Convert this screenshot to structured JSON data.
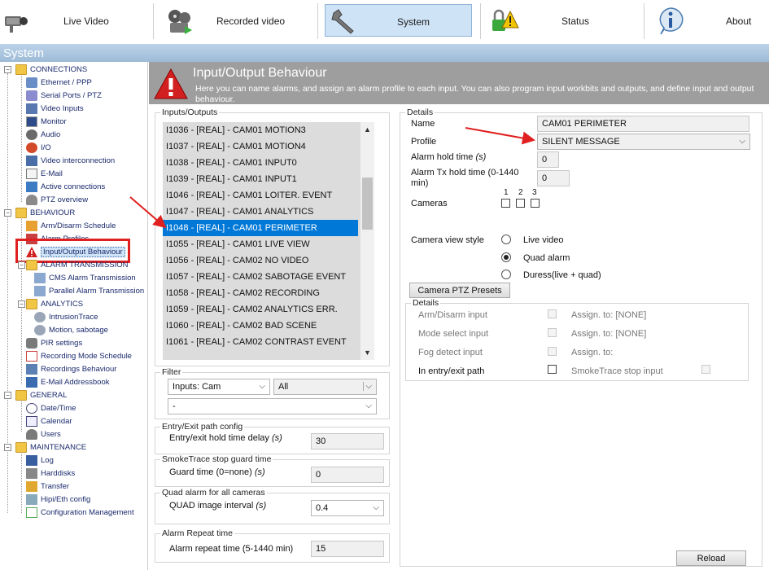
{
  "toolbar": {
    "live_video": "Live Video",
    "recorded_video": "Recorded video",
    "system": "System",
    "status": "Status",
    "about": "About"
  },
  "section_title": "System",
  "tree": {
    "connections": "CONNECTIONS",
    "ethernet": "Ethernet / PPP",
    "serial": "Serial Ports / PTZ",
    "video_inputs": "Video Inputs",
    "monitor": "Monitor",
    "audio": "Audio",
    "io": "I/O",
    "video_interconnection": "Video interconnection",
    "email": "E-Mail",
    "active_connections": "Active connections",
    "ptz_overview": "PTZ overview",
    "behaviour": "BEHAVIOUR",
    "arm_disarm_schedule": "Arm/Disarm Schedule",
    "alarm_profiles": "Alarm Profiles",
    "io_behaviour": "Input/Output Behaviour",
    "alarm_transmission": "ALARM TRANSMISSION",
    "cms_alarm": "CMS Alarm Transmission",
    "parallel_alarm": "Parallel Alarm Transmission",
    "analytics": "ANALYTICS",
    "intrusiontrace": "IntrusionTrace",
    "motion_sabotage": "Motion, sabotage",
    "pir_settings": "PIR settings",
    "recording_mode": "Recording Mode Schedule",
    "recordings_behaviour": "Recordings Behaviour",
    "email_addressbook": "E-Mail Addressbook",
    "general": "GENERAL",
    "date_time": "Date/Time",
    "calendar": "Calendar",
    "users": "Users",
    "maintenance": "MAINTENANCE",
    "log": "Log",
    "harddisks": "Harddisks",
    "transfer": "Transfer",
    "hipi": "Hipi/Eth config",
    "config_mgmt": "Configuration Management"
  },
  "header": {
    "title": "Input/Output Behaviour",
    "description": "Here you can name alarms, and assign an alarm profile to each input. You can also program input workbits and outputs, and define input and output behaviour."
  },
  "io_list": {
    "legend": "Inputs/Outputs",
    "items": [
      "I1036 - [REAL] - CAM01 MOTION3",
      "I1037 - [REAL] - CAM01 MOTION4",
      "I1038 - [REAL] - CAM01 INPUT0",
      "I1039 - [REAL] - CAM01 INPUT1",
      "I1046 - [REAL] - CAM01 LOITER. EVENT",
      "I1047 - [REAL] - CAM01 ANALYTICS",
      "I1048 - [REAL] - CAM01 PERIMETER",
      "I1055 - [REAL] - CAM01 LIVE VIEW",
      "I1056 - [REAL] - CAM02 NO VIDEO",
      "I1057 - [REAL] - CAM02 SABOTAGE EVENT",
      "I1058 - [REAL] - CAM02 RECORDING",
      "I1059 - [REAL] - CAM02 ANALYTICS ERR.",
      "I1060 - [REAL] - CAM02 BAD SCENE",
      "I1061 - [REAL] - CAM02 CONTRAST EVENT"
    ]
  },
  "filter": {
    "legend": "Filter",
    "type_value": "Inputs: Cam",
    "scope_value": "All",
    "sub_value": "-"
  },
  "entry_exit": {
    "legend": "Entry/Exit path config",
    "label": "Entry/exit hold time delay",
    "unit": "(s)",
    "value": "30"
  },
  "smoketrace": {
    "legend": "SmokeTrace stop guard time",
    "label": "Guard time (0=none)",
    "unit": "(s)",
    "value": "0"
  },
  "quad": {
    "legend": "Quad alarm for all cameras",
    "label": "QUAD image interval",
    "unit": "(s)",
    "value": "0.4"
  },
  "alarm_repeat": {
    "legend": "Alarm Repeat time",
    "label": "Alarm repeat time (5-1440 min)",
    "value": "15"
  },
  "details": {
    "legend": "Details",
    "name_label": "Name",
    "name_value": "CAM01 PERIMETER",
    "profile_label": "Profile",
    "profile_value": "SILENT MESSAGE",
    "hold_label": "Alarm hold time",
    "hold_unit": "(s)",
    "hold_value": "0",
    "tx_hold_label": "Alarm Tx hold time (0-1440 min)",
    "tx_hold_value": "0",
    "cameras_label": "Cameras",
    "cam1": "1",
    "cam2": "2",
    "cam3": "3",
    "view_style_label": "Camera view style",
    "view_live": "Live video",
    "view_quad": "Quad alarm",
    "view_duress": "Duress(live + quad)",
    "ptz_presets": "Camera PTZ Presets"
  },
  "details2": {
    "legend": "Details",
    "arm_disarm": "Arm/Disarm input",
    "assign_none1": "Assign. to: [NONE]",
    "mode_select": "Mode select input",
    "assign_none2": "Assign. to: [NONE]",
    "fog_detect": "Fog detect input",
    "assign_to": "Assign. to:",
    "entry_exit": "In entry/exit path",
    "smoketrace_stop": "SmokeTrace stop input"
  },
  "reload": "Reload",
  "colors": {
    "selected": "#0078d7",
    "annotation": "#e02020"
  }
}
